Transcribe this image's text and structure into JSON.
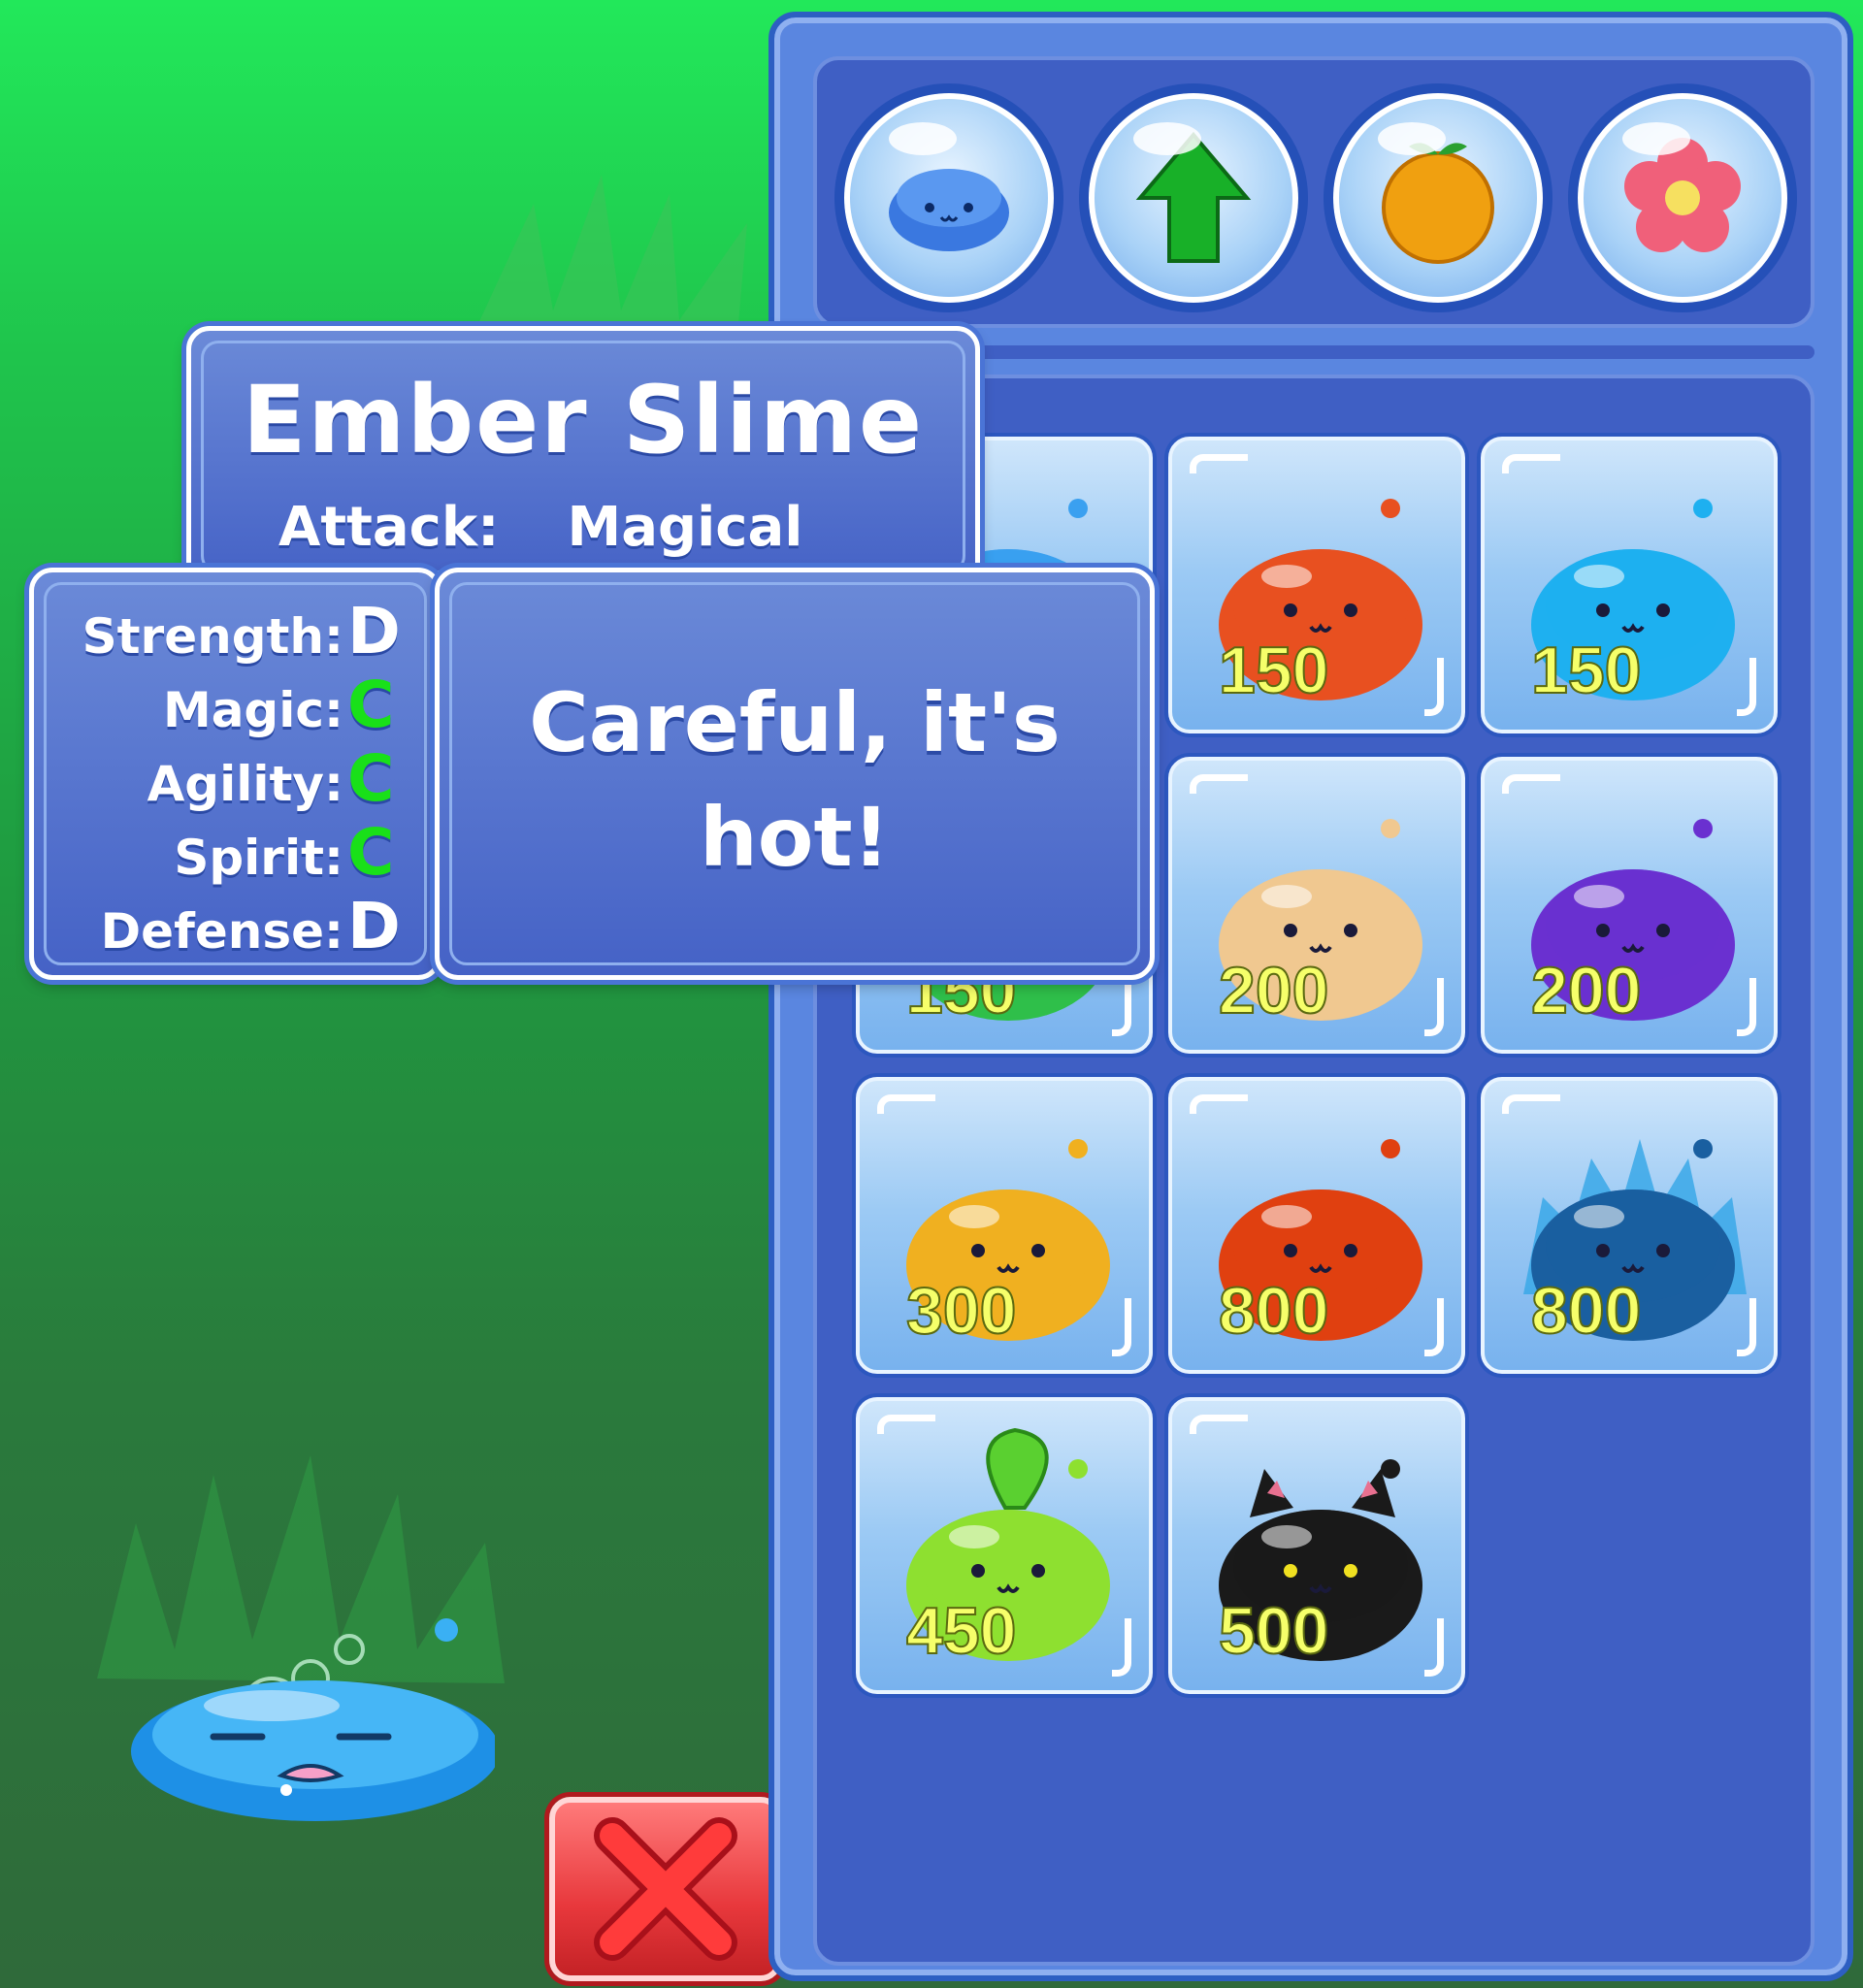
{
  "tabs": [
    {
      "icon": "slime-icon"
    },
    {
      "icon": "upgrade-arrow-icon"
    },
    {
      "icon": "orange-fruit-icon"
    },
    {
      "icon": "flower-icon"
    }
  ],
  "info": {
    "name": "Ember Slime",
    "attack_label": "Attack:",
    "attack_value": "Magical",
    "quote": "Careful, it's hot!",
    "stats": [
      {
        "label": "Strength:",
        "grade": "D",
        "color": "#ffffff"
      },
      {
        "label": "Magic:",
        "grade": "C",
        "color": "#19e019"
      },
      {
        "label": "Agility:",
        "grade": "C",
        "color": "#19e019"
      },
      {
        "label": "Spirit:",
        "grade": "C",
        "color": "#19e019"
      },
      {
        "label": "Defense:",
        "grade": "D",
        "color": "#ffffff"
      }
    ]
  },
  "shop_items": [
    {
      "slime": "blue-slime",
      "price": "",
      "color": "#3aa0f0"
    },
    {
      "slime": "ember-slime",
      "price": "150",
      "color": "#e85020"
    },
    {
      "slime": "aqua-slime",
      "price": "150",
      "color": "#1eb0f0"
    },
    {
      "slime": "green-slime",
      "price": "150",
      "color": "#2fbf4a"
    },
    {
      "slime": "bread-slime",
      "price": "200",
      "color": "#f0c890"
    },
    {
      "slime": "purple-slime",
      "price": "200",
      "color": "#6a30d0"
    },
    {
      "slime": "honey-slime",
      "price": "300",
      "color": "#f0b020"
    },
    {
      "slime": "lava-slime",
      "price": "800",
      "color": "#e04010"
    },
    {
      "slime": "spiky-slime",
      "price": "800",
      "color": "#1a5fa0"
    },
    {
      "slime": "leaf-slime",
      "price": "450",
      "color": "#8ee030"
    },
    {
      "slime": "cat-slime",
      "price": "500",
      "color": "#1a1a1a"
    }
  ],
  "price_color": "#f6ff6a",
  "player_slime": "sleeping-blue-slime"
}
